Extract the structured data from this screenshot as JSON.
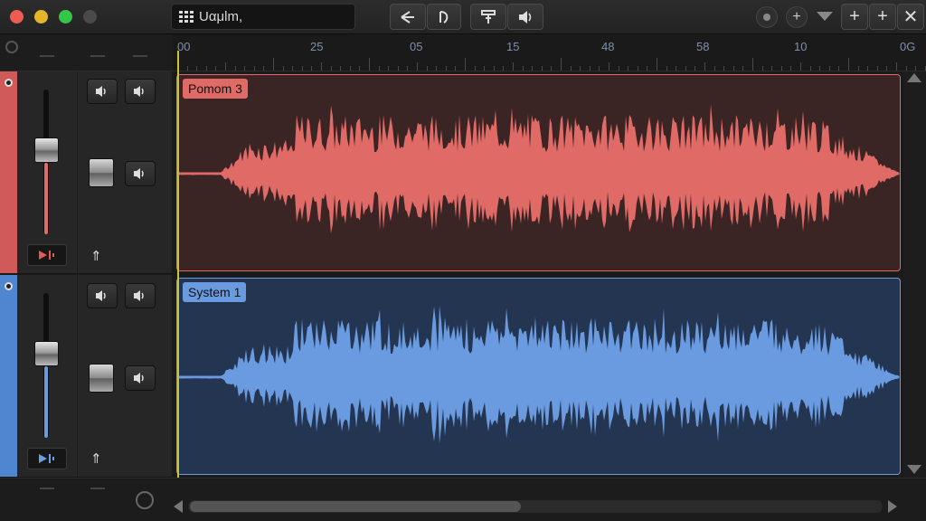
{
  "window": {
    "project_name": "Uαμlm,",
    "traffic_lights": [
      "close",
      "minimize",
      "zoom",
      "extra"
    ]
  },
  "toolbar": {
    "buttons": [
      "back-arrow-icon",
      "pen-tool-icon",
      "filter-icon",
      "speaker-icon"
    ],
    "right_buttons": [
      "circle-icon",
      "add-icon",
      "dropdown-icon",
      "plus-icon",
      "plus-icon",
      "close-icon"
    ]
  },
  "ruler": {
    "labels": [
      "00",
      "25",
      "05",
      "15",
      "48",
      "58",
      "10",
      "0G"
    ]
  },
  "tracks": [
    {
      "name": "Pomom 3",
      "color": "#e06a66",
      "strip_color": "#d05a5a",
      "region_bg": "#3a2424",
      "fader_level": 0.58
    },
    {
      "name": "System 1",
      "color": "#6a9be0",
      "strip_color": "#4f86cf",
      "region_bg": "#233550",
      "fader_level": 0.58
    }
  ],
  "colors": {
    "playhead": "#c9c33a",
    "background": "#1b1b1b"
  }
}
